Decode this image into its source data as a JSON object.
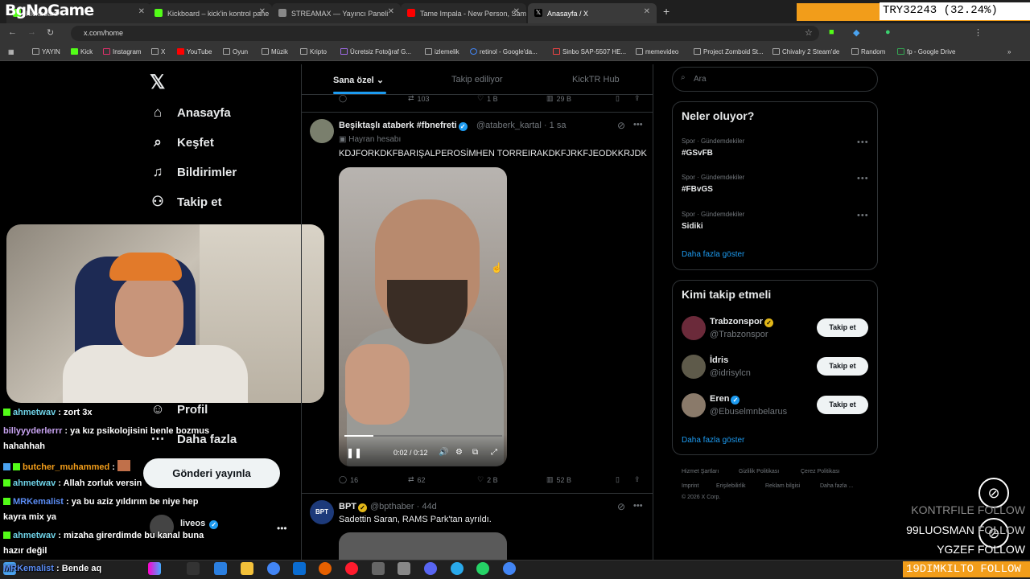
{
  "browser": {
    "tabs": [
      {
        "label": "Kickboard",
        "fav": "#53fc18"
      },
      {
        "label": "Kickboard – kick'in kontrol pane",
        "fav": "#53fc18"
      },
      {
        "label": "STREAMAX — Yayıncı Paneli",
        "fav": "#888888"
      },
      {
        "label": "Tame Impala - New Person, Sam",
        "fav": "#ff0000"
      },
      {
        "label": "Anasayfa / X",
        "fav": "#000000"
      }
    ],
    "new_tab": "+",
    "url": "x.com/home",
    "bookmarks": [
      "YAYIN",
      "Kick",
      "Instagram",
      "X",
      "YouTube",
      "Oyun",
      "Müzik",
      "Kripto",
      "Ücretsiz Fotoğraf G...",
      "izlemelik",
      "retinol - Google'da...",
      "Sinbo SAP-5507 HE...",
      "memevideo",
      "Project Zomboid St...",
      "Chivalry 2 Steam'de",
      "Random",
      "fp - Google Drive"
    ]
  },
  "overlay": {
    "logo": "BgNoGame",
    "try": "TRY32243 (32.24%)",
    "follows": [
      {
        "name": "KONTRFILE",
        "tag": "FOLLOW"
      },
      {
        "name": "99LUOSMAN",
        "tag": "FOLLOW"
      },
      {
        "name": "YGZEF",
        "tag": "FOLLOW"
      }
    ],
    "last_follow": "19DIMKILTO  FOLLOW"
  },
  "nav": {
    "items": [
      {
        "label": "Anasayfa",
        "icon": "home-icon"
      },
      {
        "label": "Keşfet",
        "icon": "search-icon"
      },
      {
        "label": "Bildirimler",
        "icon": "bell-icon"
      },
      {
        "label": "Takip et",
        "icon": "add-user-icon"
      }
    ],
    "profile": "Profil",
    "more": "Daha fazla",
    "post_button": "Gönderi yayınla",
    "account_name": "liveos"
  },
  "feed": {
    "tabs": [
      "Sana özel",
      "Takip ediliyor",
      "KickTR Hub"
    ],
    "prev_actions": {
      "replies": "",
      "reposts": "103",
      "likes": "1 B",
      "views": "29 B"
    },
    "tweet1": {
      "name": "Beşiktaşlı ataberk #fbnefreti",
      "handle": "@ataberk_kartal · 1 sa",
      "fan": "Hayran hesabı",
      "text": "KDJFORKDKFBARIŞALPEROSİMHEN TORREIRAKDKFJRKFJEODKKRJDK",
      "video_time": "0:02 / 0:12",
      "replies": "16",
      "reposts": "62",
      "likes": "2 B",
      "views": "52 B"
    },
    "tweet2": {
      "name": "BPT",
      "handle": "@bpthaber · 44d",
      "text": "Sadettin Saran, RAMS Park'tan ayrıldı."
    }
  },
  "sidebar": {
    "search_placeholder": "Ara",
    "trends_title": "Neler oluyor?",
    "trends": [
      {
        "meta": "Spor · Gündemdekiler",
        "tag": "#GSvFB"
      },
      {
        "meta": "Spor · Gündemdekiler",
        "tag": "#FBvGS"
      },
      {
        "meta": "Spor · Gündemdekiler",
        "tag": "Sidiki"
      }
    ],
    "show_more": "Daha fazla göster",
    "who_title": "Kimi takip etmeli",
    "who": [
      {
        "name": "Trabzonspor",
        "handle": "@Trabzonspor",
        "button": "Takip et"
      },
      {
        "name": "İdris",
        "handle": "@idrisylcn",
        "button": "Takip et"
      },
      {
        "name": "Eren",
        "handle": "@Ebuselmnbelarus",
        "button": "Takip et"
      }
    ],
    "who_more": "Daha fazla göster",
    "footer1": [
      "Hizmet Şartları",
      "Gizlilik Politikası",
      "Çerez Politikası"
    ],
    "footer2": [
      "Imprint",
      "Erişilebilirlik",
      "Reklam bilgisi",
      "Daha fazla ..."
    ],
    "copyright": "© 2026 X Corp."
  },
  "chat": [
    {
      "user": "ahmetwav",
      "msg": " : zort 3x"
    },
    {
      "user": "billyyyderlerrr",
      "msg": " : ya kız psikolojisini benle bozmus"
    },
    {
      "user": "",
      "msg": "hahahhah"
    },
    {
      "user": "butcher_muhammed",
      "msg": " : "
    },
    {
      "user": "ahmetwav",
      "msg": " : Allah zorluk versin"
    },
    {
      "user": "MRKemalist",
      "msg": " : ya bu aziz yıldırım be niye hep"
    },
    {
      "user": "",
      "msg": "kayra mix ya"
    },
    {
      "user": "ahmetwav",
      "msg": " : mizaha girerdimde bu kanal buna"
    },
    {
      "user": "",
      "msg": "hazır değil"
    },
    {
      "user": "MRKemalist",
      "msg": " : Bende aq"
    }
  ]
}
